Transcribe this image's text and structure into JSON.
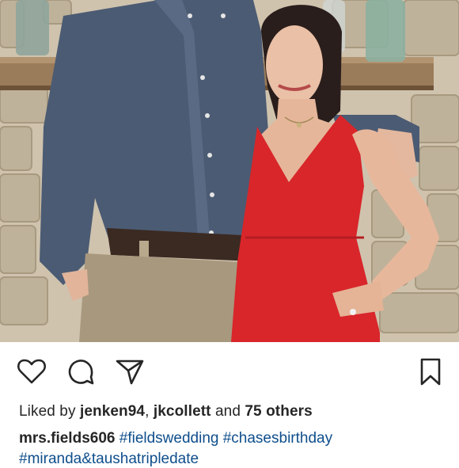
{
  "post": {
    "photo_alt": "couple-photo",
    "actions": {
      "like_icon": "heart-icon",
      "comment_icon": "comment-icon",
      "share_icon": "send-icon",
      "save_icon": "bookmark-icon"
    },
    "likes": {
      "prefix": "Liked by",
      "user1": "jenken94",
      "separator": ",",
      "user2": "jkcollett",
      "middle": "and",
      "others": "75 others"
    },
    "caption": {
      "username": "mrs.fields606",
      "tags": [
        "#fieldswedding",
        "#chasesbirthday"
      ],
      "tags_line2": "#miranda&taushatripledate"
    }
  },
  "colors": {
    "text": "#262626",
    "hashtag": "#0f4e8c",
    "dress": "#d8262a",
    "shirt": "#4a5a72"
  }
}
